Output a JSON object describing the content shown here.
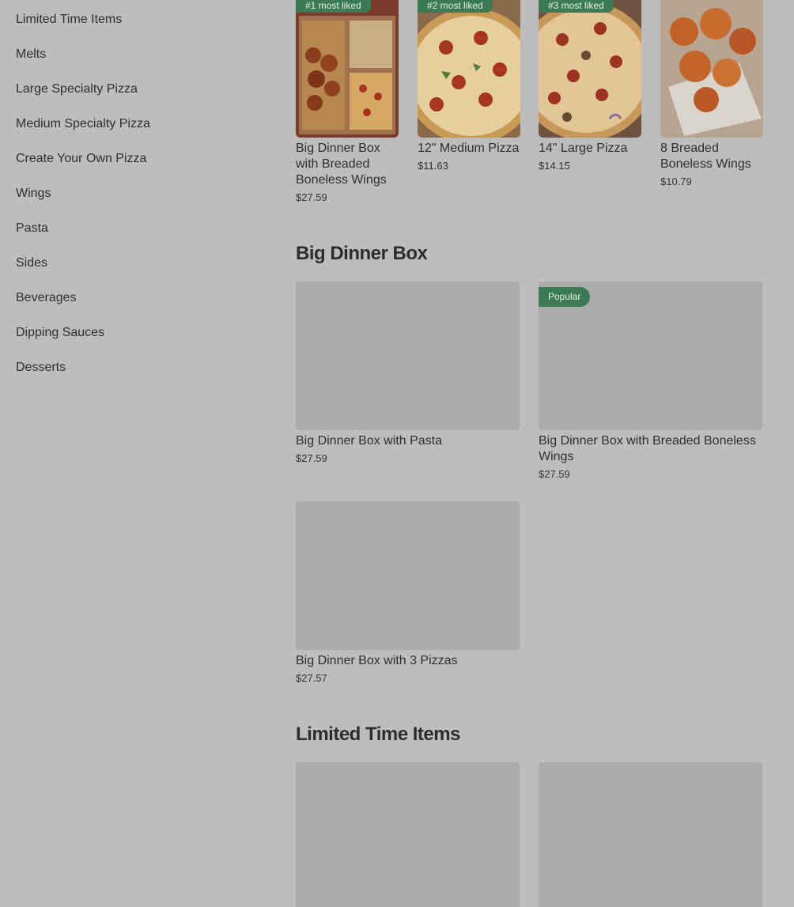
{
  "sidebar": {
    "items": [
      {
        "label": "Limited Time Items"
      },
      {
        "label": "Melts"
      },
      {
        "label": "Large Specialty Pizza"
      },
      {
        "label": "Medium Specialty Pizza"
      },
      {
        "label": "Create Your Own Pizza"
      },
      {
        "label": "Wings"
      },
      {
        "label": "Pasta"
      },
      {
        "label": "Sides"
      },
      {
        "label": "Beverages"
      },
      {
        "label": "Dipping Sauces"
      },
      {
        "label": "Desserts"
      }
    ]
  },
  "most_liked": [
    {
      "badge": "#1 most liked",
      "name": "Big Dinner Box with Breaded Boneless Wings",
      "price": "$27.59"
    },
    {
      "badge": "#2 most liked",
      "name": "12\" Medium Pizza",
      "price": "$11.63"
    },
    {
      "badge": "#3 most liked",
      "name": "14\" Large Pizza",
      "price": "$14.15"
    },
    {
      "badge": "",
      "name": "8 Breaded Boneless Wings",
      "price": "$10.79"
    }
  ],
  "sections": [
    {
      "title": "Big Dinner Box",
      "items": [
        {
          "name": "Big Dinner Box with Pasta",
          "price": "$27.59",
          "badge": ""
        },
        {
          "name": "Big Dinner Box with Breaded Boneless Wings",
          "price": "$27.59",
          "badge": "Popular"
        },
        {
          "name": "Big Dinner Box with 3 Pizzas",
          "price": "$27.57",
          "badge": ""
        }
      ]
    },
    {
      "title": "Limited Time Items",
      "items": []
    }
  ],
  "colors": {
    "background": "#bdbdbd",
    "placeholder": "#ababab",
    "badge": "#3c7a55"
  }
}
